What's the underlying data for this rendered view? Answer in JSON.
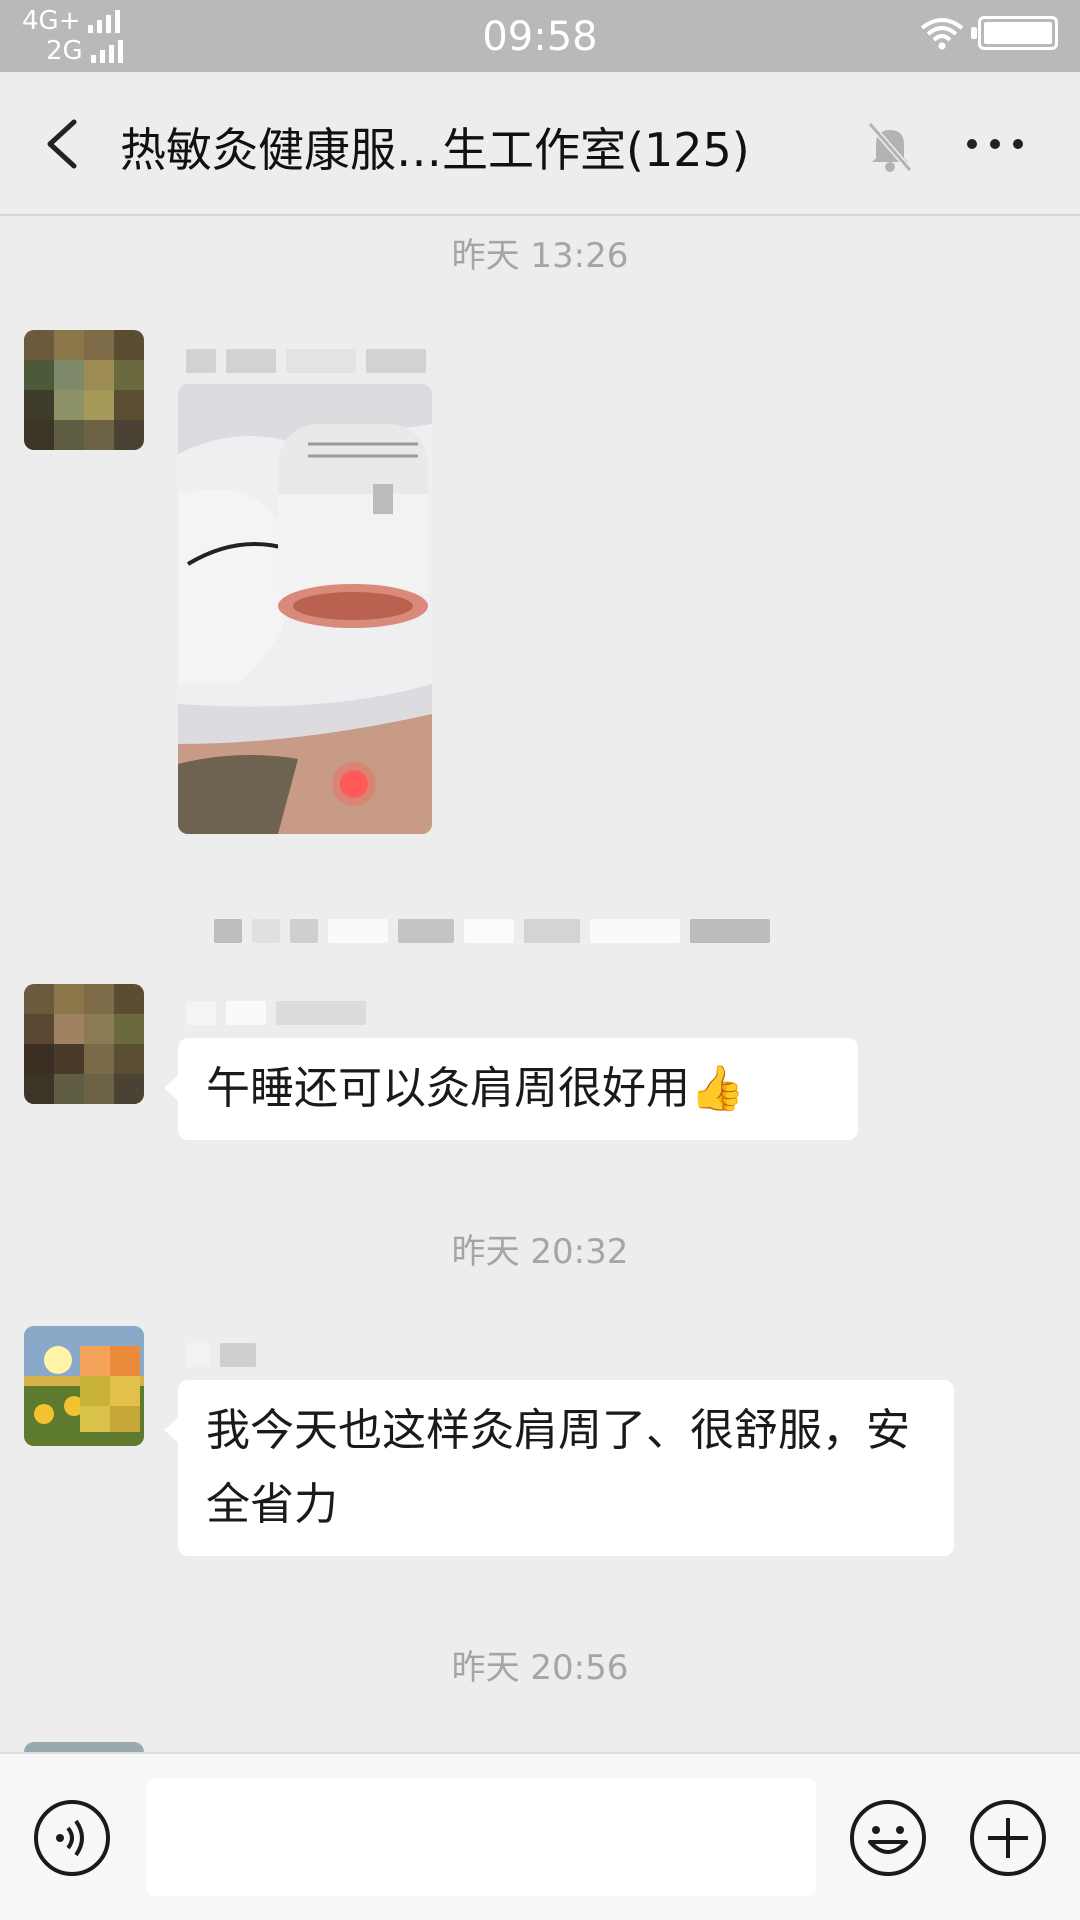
{
  "status_bar": {
    "network_1": "4G+",
    "network_2": "2G",
    "time": "09:58"
  },
  "nav": {
    "title": "热敏灸健康服…生工作室(125)",
    "back_icon": "chevron-left-icon",
    "mute_icon": "bell-off-icon",
    "more_icon": "ellipsis-icon"
  },
  "chat": {
    "time_1": "昨天 13:26",
    "message_2_text": "午睡还可以灸肩周很好用👍",
    "time_2": "昨天 20:32",
    "message_3_text": "我今天也这样灸肩周了、很舒服，安全省力",
    "time_3": "昨天 20:56"
  },
  "input_bar": {
    "voice_icon": "voice-icon",
    "emoji_icon": "emoji-icon",
    "plus_icon": "plus-icon",
    "placeholder": ""
  },
  "colors": {
    "status_bar_bg": "#b9b9b9",
    "chat_bg": "#ededed",
    "bubble_bg": "#ffffff",
    "time_label": "#a5a5a5"
  }
}
